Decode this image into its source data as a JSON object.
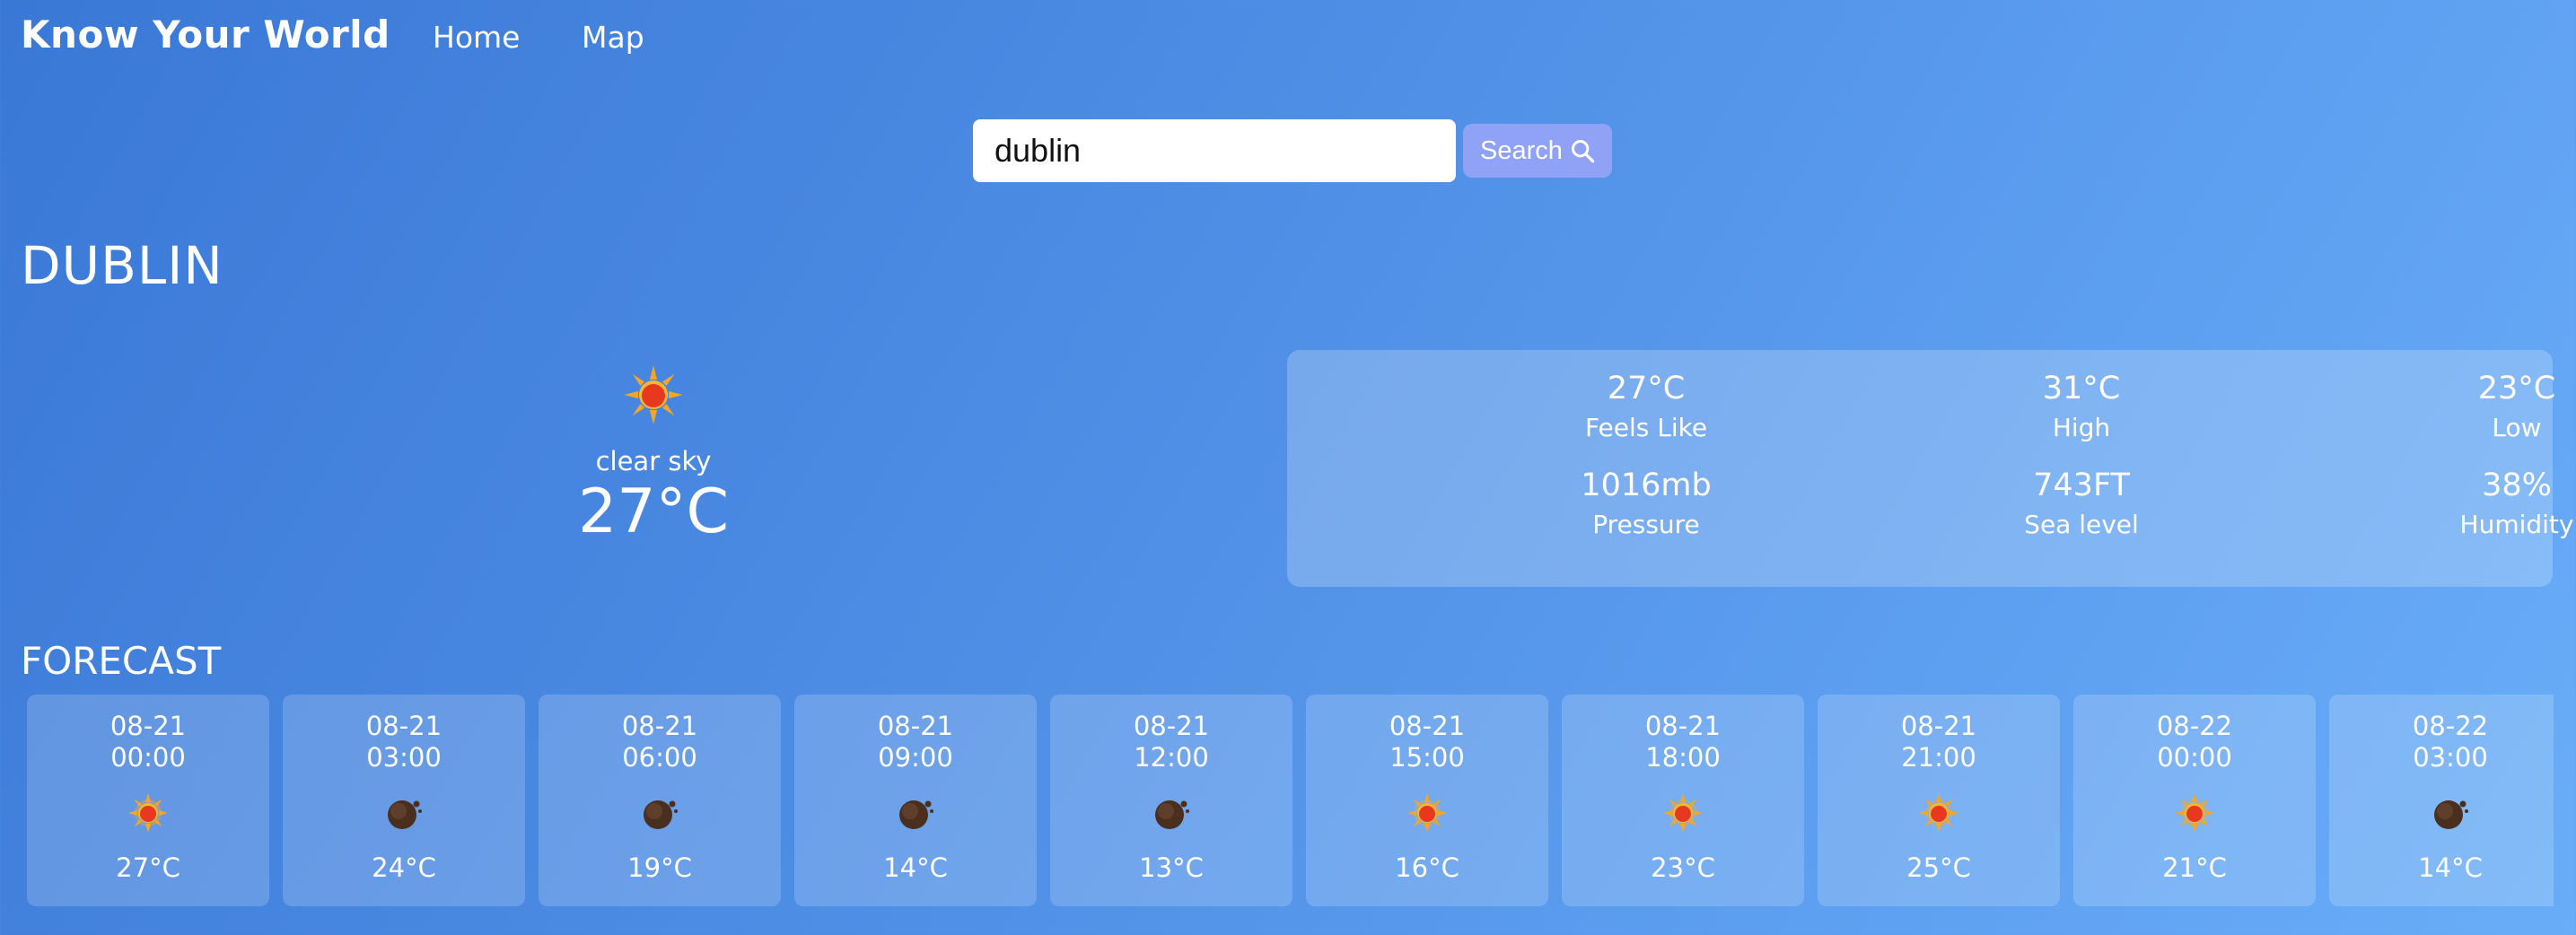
{
  "nav": {
    "brand": "Know Your World",
    "links": [
      "Home",
      "Map"
    ]
  },
  "search": {
    "value": "dublin",
    "button_label": "Search"
  },
  "city": "DUBLIN",
  "current": {
    "icon": "sun-icon",
    "description": "clear sky",
    "temp": "27°C"
  },
  "details": [
    {
      "value": "27°C",
      "label": "Feels Like"
    },
    {
      "value": "31°C",
      "label": "High"
    },
    {
      "value": "23°C",
      "label": "Low"
    },
    {
      "value": "1016mb",
      "label": "Pressure"
    },
    {
      "value": "743FT",
      "label": "Sea level"
    },
    {
      "value": "38%",
      "label": "Humidity"
    }
  ],
  "forecast": {
    "title": "FORECAST",
    "items": [
      {
        "date": "08-21",
        "time": "00:00",
        "icon": "sun-icon",
        "temp": "27°C"
      },
      {
        "date": "08-21",
        "time": "03:00",
        "icon": "moon-icon",
        "temp": "24°C"
      },
      {
        "date": "08-21",
        "time": "06:00",
        "icon": "moon-icon",
        "temp": "19°C"
      },
      {
        "date": "08-21",
        "time": "09:00",
        "icon": "moon-icon",
        "temp": "14°C"
      },
      {
        "date": "08-21",
        "time": "12:00",
        "icon": "moon-icon",
        "temp": "13°C"
      },
      {
        "date": "08-21",
        "time": "15:00",
        "icon": "sun-icon",
        "temp": "16°C"
      },
      {
        "date": "08-21",
        "time": "18:00",
        "icon": "sun-icon",
        "temp": "23°C"
      },
      {
        "date": "08-21",
        "time": "21:00",
        "icon": "sun-icon",
        "temp": "25°C"
      },
      {
        "date": "08-22",
        "time": "00:00",
        "icon": "sun-icon",
        "temp": "21°C"
      },
      {
        "date": "08-22",
        "time": "03:00",
        "icon": "moon-icon",
        "temp": "14°C"
      }
    ]
  },
  "colors": {
    "search_button": "#8fa2f5",
    "background_start": "#3a78d6",
    "background_end": "#69adf8"
  }
}
